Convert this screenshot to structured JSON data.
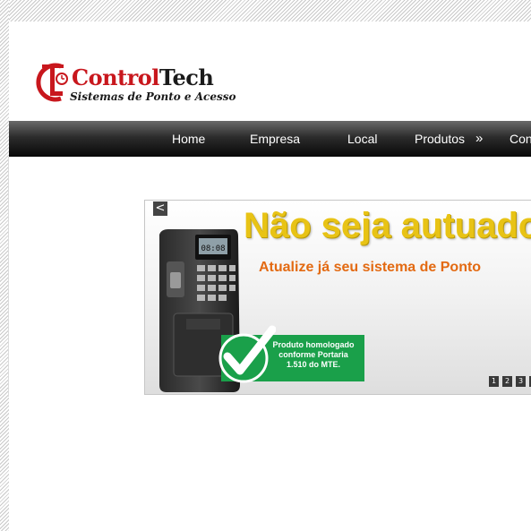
{
  "brand": {
    "name_first": "Control",
    "name_second": "Tech",
    "tagline": "Sistemas de Ponto e Acesso",
    "logo_letters": "CT",
    "accent_color": "#c8171d",
    "logo_icon": "clock-icon"
  },
  "nav": {
    "items": [
      {
        "label": "Home"
      },
      {
        "label": "Empresa"
      },
      {
        "label": "Local"
      },
      {
        "label": "Produtos"
      },
      {
        "label": "Con"
      }
    ],
    "submenu_indicator": "»"
  },
  "slider": {
    "prev_label": "<",
    "headline": "Não seja autuado",
    "subheadline": "Atualize já seu sistema de Ponto",
    "badge_lines": [
      "Produto homologado",
      "conforme Portaria",
      "1.510 do MTE."
    ],
    "device_screen_text": "08:08",
    "pages": [
      "1",
      "2",
      "3"
    ],
    "headline_color": "#e8c315",
    "subheadline_color": "#e36a12",
    "badge_color": "#1aa04a"
  }
}
